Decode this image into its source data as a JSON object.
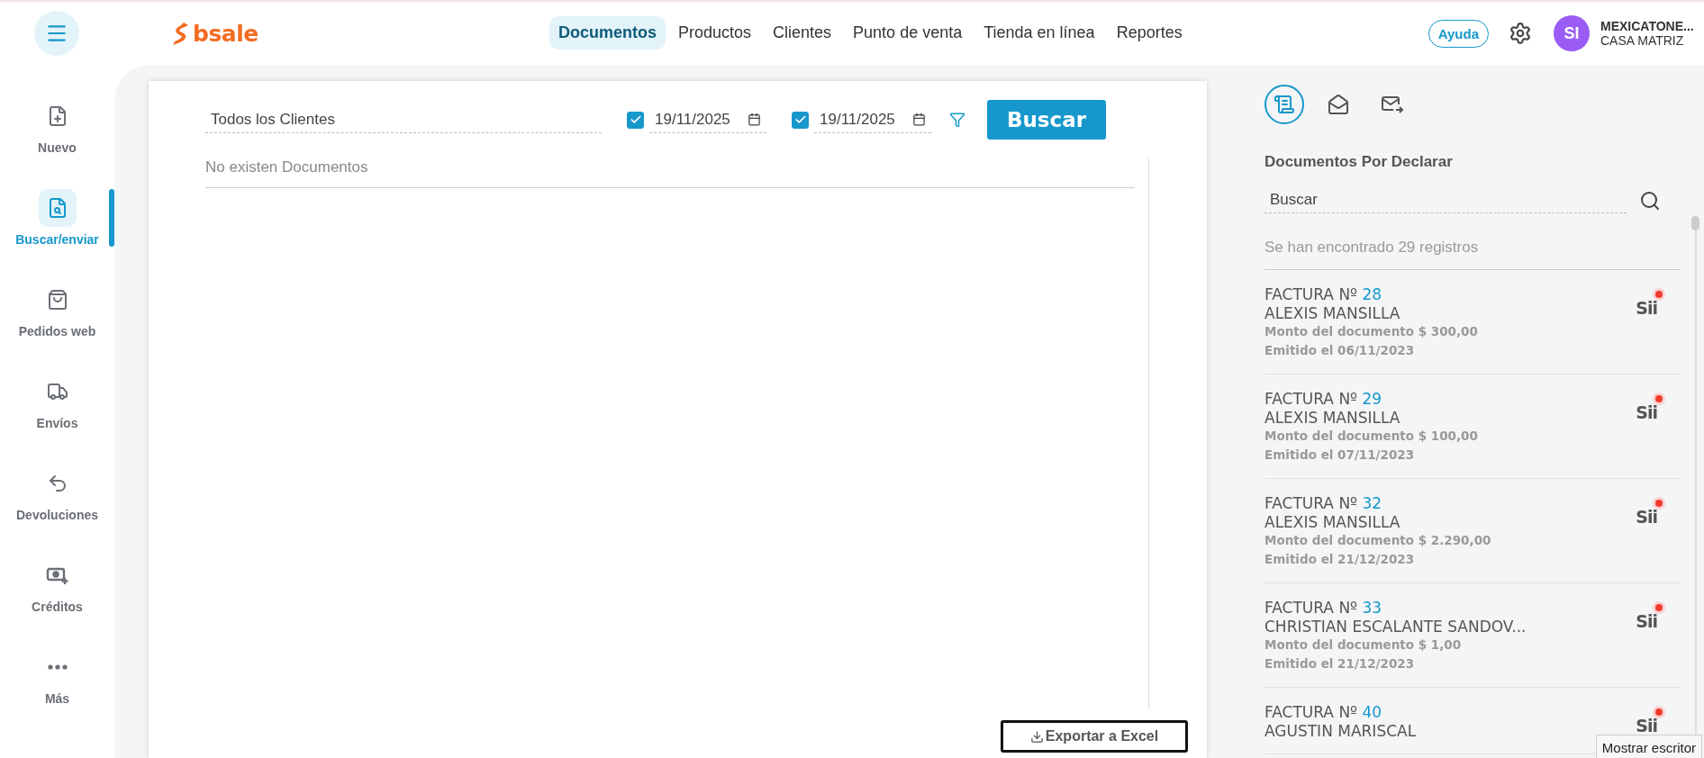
{
  "header": {
    "logo": "bsale",
    "nav": [
      {
        "label": "Documentos",
        "selected": true
      },
      {
        "label": "Productos",
        "selected": false
      },
      {
        "label": "Clientes",
        "selected": false
      },
      {
        "label": "Punto de venta",
        "selected": false
      },
      {
        "label": "Tienda en línea",
        "selected": false
      },
      {
        "label": "Reportes",
        "selected": false
      }
    ],
    "help": "Ayuda",
    "avatar": "SI",
    "account_name": "MEXICATONE...",
    "account_branch": "CASA MATRIZ"
  },
  "sidebar": {
    "items": [
      {
        "kind": "new",
        "label": "Nuevo",
        "selected": false
      },
      {
        "kind": "search",
        "label": "Buscar/enviar",
        "selected": true
      },
      {
        "kind": "bag",
        "label": "Pedidos web",
        "selected": false
      },
      {
        "kind": "truck",
        "label": "Envíos",
        "selected": false
      },
      {
        "kind": "return",
        "label": "Devoluciones",
        "selected": false
      },
      {
        "kind": "credit",
        "label": "Créditos",
        "selected": false
      },
      {
        "kind": "more",
        "label": "Más",
        "selected": false
      }
    ]
  },
  "filters": {
    "client": "Todos los Clientes",
    "from": {
      "checked": true,
      "value": "19/11/2025"
    },
    "to": {
      "checked": true,
      "value": "19/11/2025"
    },
    "search_button": "Buscar"
  },
  "results": {
    "empty_message": "No existen Documentos",
    "export_button": "Exportar a Excel"
  },
  "side_panel": {
    "tabs": [
      {
        "kind": "receipt",
        "selected": true
      },
      {
        "kind": "inbox",
        "selected": false
      },
      {
        "kind": "send",
        "selected": false
      }
    ],
    "title": "Documentos Por Declarar",
    "search_placeholder": "Buscar",
    "count": "Se han encontrado 29 registros",
    "documents": [
      {
        "type": "FACTURA Nº",
        "number": "28",
        "client": "ALEXIS MANSILLA",
        "amount": "Monto del documento $ 300,00",
        "issued": "Emitido el 06/11/2023",
        "badge": "Sii",
        "pending": true
      },
      {
        "type": "FACTURA Nº",
        "number": "29",
        "client": "ALEXIS MANSILLA",
        "amount": "Monto del documento $ 100,00",
        "issued": "Emitido el 07/11/2023",
        "badge": "Sii",
        "pending": true
      },
      {
        "type": "FACTURA Nº",
        "number": "32",
        "client": "ALEXIS MANSILLA",
        "amount": "Monto del documento $ 2.290,00",
        "issued": "Emitido el 21/12/2023",
        "badge": "Sii",
        "pending": true
      },
      {
        "type": "FACTURA Nº",
        "number": "33",
        "client": "CHRISTIAN ESCALANTE SANDOV...",
        "amount": "Monto del documento $ 1,00",
        "issued": "Emitido el 21/12/2023",
        "badge": "Sii",
        "pending": true
      },
      {
        "type": "FACTURA Nº",
        "number": "40",
        "client": "AGUSTIN MARISCAL",
        "badge": "Sii",
        "pending": true
      }
    ]
  },
  "tooltip": "Mostrar escritor"
}
